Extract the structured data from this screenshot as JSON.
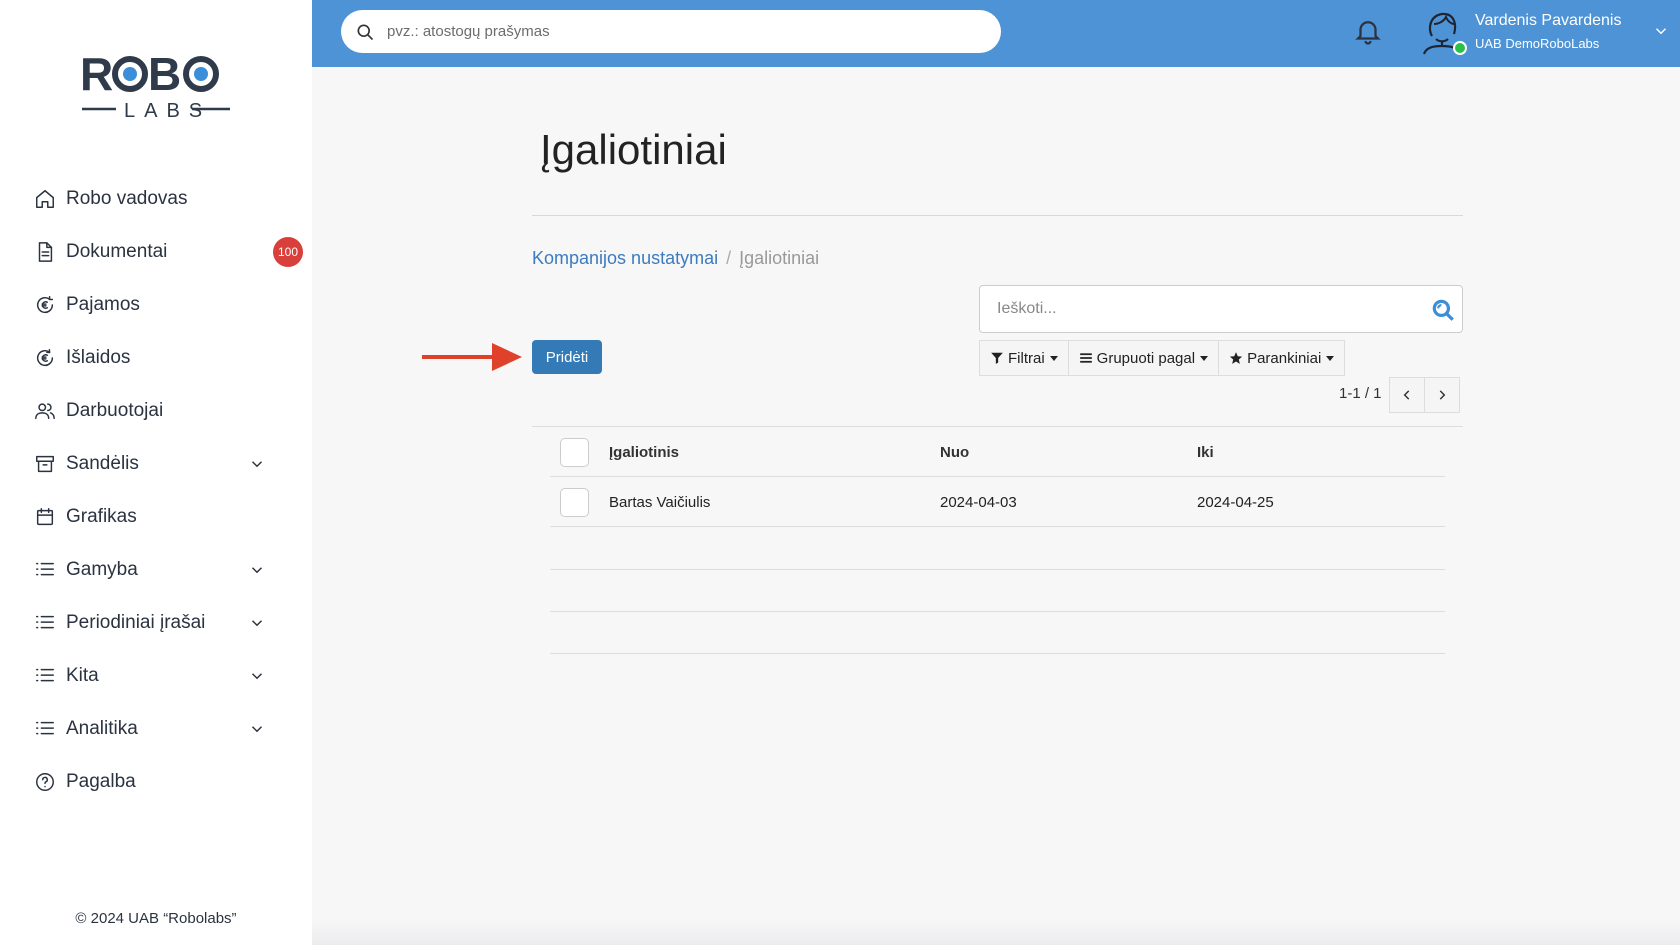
{
  "top_search": {
    "placeholder": "pvz.: atostogų prašymas"
  },
  "user": {
    "name": "Vardenis Pavardenis",
    "company": "UAB DemoRoboLabs"
  },
  "logo": {
    "text_top": "ROBO",
    "text_bottom": "LABS"
  },
  "sidebar": {
    "items": [
      {
        "label": "Robo vadovas",
        "icon": "home-icon"
      },
      {
        "label": "Dokumentai",
        "icon": "document-icon",
        "badge": "100"
      },
      {
        "label": "Pajamos",
        "icon": "euro-income-icon"
      },
      {
        "label": "Išlaidos",
        "icon": "euro-expense-icon"
      },
      {
        "label": "Darbuotojai",
        "icon": "users-icon"
      },
      {
        "label": "Sandėlis",
        "icon": "archive-icon",
        "expandable": true
      },
      {
        "label": "Grafikas",
        "icon": "calendar-icon"
      },
      {
        "label": "Gamyba",
        "icon": "list-icon",
        "expandable": true
      },
      {
        "label": "Periodiniai įrašai",
        "icon": "list-icon",
        "expandable": true
      },
      {
        "label": "Kita",
        "icon": "list-icon",
        "expandable": true
      },
      {
        "label": "Analitika",
        "icon": "list-icon",
        "expandable": true
      },
      {
        "label": "Pagalba",
        "icon": "help-icon"
      }
    ],
    "copyright": "© 2024 UAB “Robolabs”"
  },
  "main": {
    "title": "Įgaliotiniai",
    "breadcrumb": {
      "parent": "Kompanijos nustatymai",
      "separator": "/",
      "current": "Įgaliotiniai"
    },
    "search_placeholder": "Ieškoti...",
    "add_label": "Pridėti",
    "filters": {
      "filter_label": "Filtrai",
      "group_label": "Grupuoti pagal",
      "favorites_label": "Parankiniai"
    },
    "pager": "1-1 / 1",
    "table": {
      "columns": [
        "Įgaliotinis",
        "Nuo",
        "Iki"
      ],
      "rows": [
        {
          "name": "Bartas Vaičiulis",
          "from": "2024-04-03",
          "to": "2024-04-25"
        }
      ]
    }
  },
  "colors": {
    "topbar": "#4d93d6",
    "primary_button": "#337ab7",
    "badge": "#d9403b",
    "link": "#3b7bbf",
    "arrow": "#e0412a"
  }
}
